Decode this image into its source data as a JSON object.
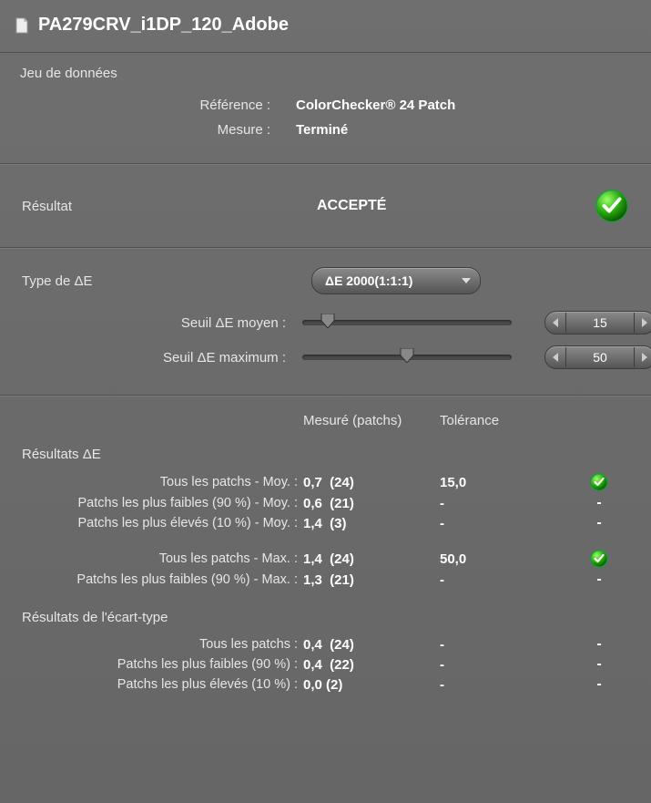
{
  "title": "PA279CRV_i1DP_120_Adobe",
  "dataset": {
    "section_label": "Jeu de données",
    "reference_label": "Référence :",
    "reference_value": "ColorChecker® 24 Patch",
    "measure_label": "Mesure :",
    "measure_value": "Terminé"
  },
  "result": {
    "label": "Résultat",
    "value": "ACCEPTÉ",
    "status": "ok"
  },
  "deltaE": {
    "type_label": "Type de ΔE",
    "type_value": "ΔE 2000(1:1:1)",
    "avg_threshold_label": "Seuil ΔE moyen :",
    "avg_threshold_value": "15",
    "avg_threshold_pct": 12,
    "max_threshold_label": "Seuil ΔE maximum :",
    "max_threshold_value": "50",
    "max_threshold_pct": 50
  },
  "columns": {
    "measured": "Mesuré (patchs)",
    "tolerance": "Tolérance"
  },
  "results_de": {
    "header": "Résultats ΔE",
    "rows": [
      {
        "label": "Tous les patchs - Moy. :",
        "measured": "0,7  (24)",
        "tolerance": "15,0",
        "ok": true
      },
      {
        "label": "Patchs les plus faibles (90 %) - Moy. :",
        "measured": "0,6  (21)",
        "tolerance": "-",
        "ok": null
      },
      {
        "label": "Patchs les plus élevés (10 %) - Moy. :",
        "measured": "1,4  (3)",
        "tolerance": "-",
        "ok": null
      }
    ],
    "rows2": [
      {
        "label": "Tous les patchs - Max. :",
        "measured": "1,4  (24)",
        "tolerance": "50,0",
        "ok": true
      },
      {
        "label": "Patchs les plus faibles (90 %) - Max. :",
        "measured": "1,3  (21)",
        "tolerance": "-",
        "ok": null
      }
    ]
  },
  "results_std": {
    "header": "Résultats de l'écart-type",
    "rows": [
      {
        "label": "Tous les patchs :",
        "measured": "0,4  (24)",
        "tolerance": "-",
        "ok": null
      },
      {
        "label": "Patchs les plus faibles (90 %) :",
        "measured": "0,4  (22)",
        "tolerance": "-",
        "ok": null
      },
      {
        "label": "Patchs les plus élevés (10 %) :",
        "measured": "0,0 (2)",
        "tolerance": "-",
        "ok": null
      }
    ]
  }
}
